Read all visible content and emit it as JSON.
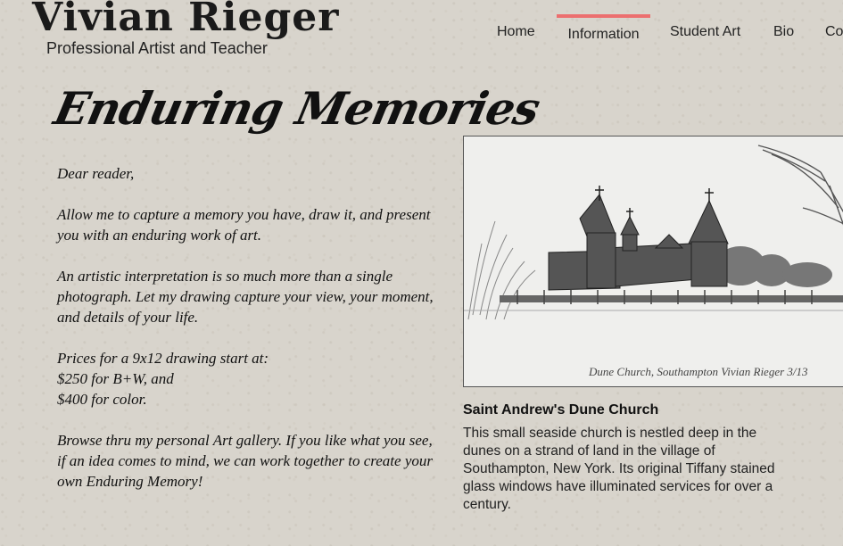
{
  "header": {
    "site_title": "Vivian Rieger",
    "tagline": "Professional Artist and Teacher"
  },
  "nav": {
    "items": [
      {
        "label": "Home"
      },
      {
        "label": "Information"
      },
      {
        "label": "Student Art"
      },
      {
        "label": "Bio"
      },
      {
        "label": "Co"
      }
    ],
    "active": "Information",
    "active_color": "#ec6f6f"
  },
  "main": {
    "heading": "Enduring Memories",
    "paragraphs": [
      "Dear reader,",
      "Allow me to capture a memory you have, draw it, and present you with an enduring work of art.",
      "An artistic interpretation is so much more than a single photograph. Let my drawing capture your view, your moment, and details of your life.",
      "Browse thru my personal Art gallery. If you like what you see, if an idea comes to mind, we can work together to create your own Enduring Memory!"
    ],
    "prices": {
      "line1": "Prices for a 9x12 drawing start at:",
      "line2": "$250 for B+W, and",
      "line3": "$400 for color."
    }
  },
  "artwork": {
    "signature": "Dune Church,   Southampton  Vivian Rieger 3/13",
    "caption_title": "Saint Andrew's Dune Church",
    "caption_text": "This small seaside church is nestled deep in the dunes on a strand of land in the village of Southampton, New York. Its original Tiffany stained glass windows have illuminated services for over a century."
  }
}
